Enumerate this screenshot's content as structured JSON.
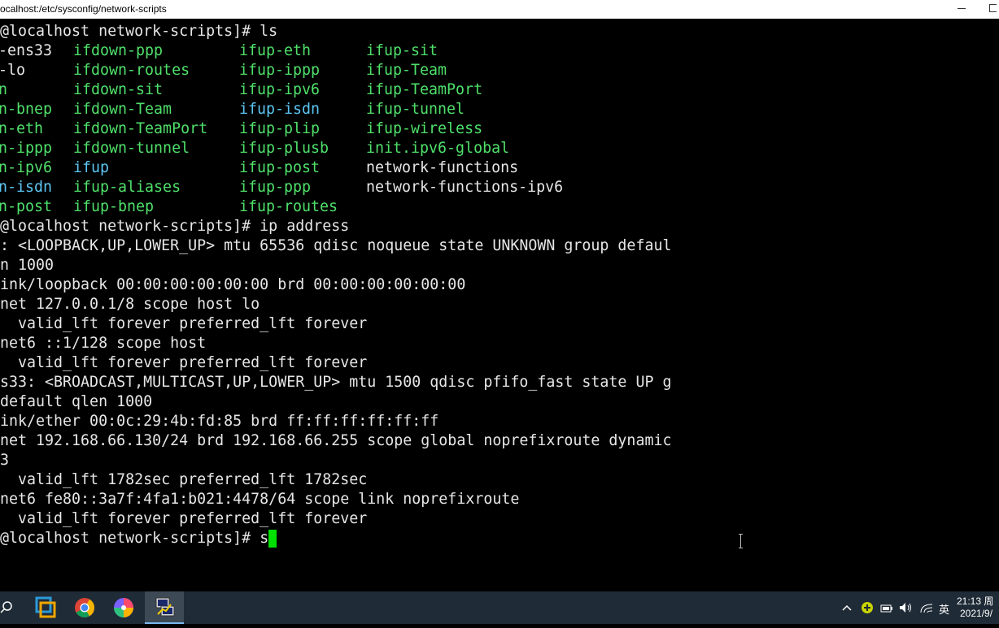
{
  "window": {
    "title": "ocalhost:/etc/sysconfig/network-scripts"
  },
  "terminal": {
    "ls_prompt": "@localhost network-scripts]# ls",
    "ls_rows": [
      [
        "-ens33",
        "ifdown-ppp",
        "ifup-eth",
        "ifup-sit"
      ],
      [
        "-lo",
        "ifdown-routes",
        "ifup-ippp",
        "ifup-Team"
      ],
      [
        "n",
        "ifdown-sit",
        "ifup-ipv6",
        "ifup-TeamPort"
      ],
      [
        "n-bnep",
        "ifdown-Team",
        "ifup-isdn",
        "ifup-tunnel"
      ],
      [
        "n-eth",
        "ifdown-TeamPort",
        "ifup-plip",
        "ifup-wireless"
      ],
      [
        "n-ippp",
        "ifdown-tunnel",
        "ifup-plusb",
        "init.ipv6-global"
      ],
      [
        "n-ipv6",
        "ifup",
        "ifup-post",
        "network-functions"
      ],
      [
        "n-isdn",
        "ifup-aliases",
        "ifup-ppp",
        "network-functions-ipv6"
      ],
      [
        "n-post",
        "ifup-bnep",
        "ifup-routes",
        ""
      ]
    ],
    "ip_prompt": "@localhost network-scripts]# ip address",
    "ip_output": [
      ": <LOOPBACK,UP,LOWER_UP> mtu 65536 qdisc noqueue state UNKNOWN group defaul",
      "n 1000",
      "ink/loopback 00:00:00:00:00:00 brd 00:00:00:00:00:00",
      "net 127.0.0.1/8 scope host lo",
      "  valid_lft forever preferred_lft forever",
      "net6 ::1/128 scope host",
      "  valid_lft forever preferred_lft forever",
      "s33: <BROADCAST,MULTICAST,UP,LOWER_UP> mtu 1500 qdisc pfifo_fast state UP g",
      "default qlen 1000",
      "ink/ether 00:0c:29:4b:fd:85 brd ff:ff:ff:ff:ff:ff",
      "net 192.168.66.130/24 brd 192.168.66.255 scope global noprefixroute dynamic",
      "3",
      "  valid_lft 1782sec preferred_lft 1782sec",
      "net6 fe80::3a7f:4fa1:b021:4478/64 scope link noprefixroute",
      "  valid_lft forever preferred_lft forever"
    ],
    "current_prompt": "@localhost network-scripts]# ",
    "current_input": "s"
  },
  "taskbar": {
    "apps": [
      "vmware-icon",
      "chrome-icon",
      "pinwheel-icon",
      "putty-icon"
    ],
    "tray": {
      "ime": "英"
    },
    "clock": {
      "time": "21:13 周",
      "date": "2021/9/"
    }
  },
  "colors": {
    "file_green": "#4fe06a",
    "file_cyan": "#5cc6f3",
    "text": "#e6e6e6",
    "cursor": "#00e000",
    "taskbar": "#1f2b36"
  }
}
